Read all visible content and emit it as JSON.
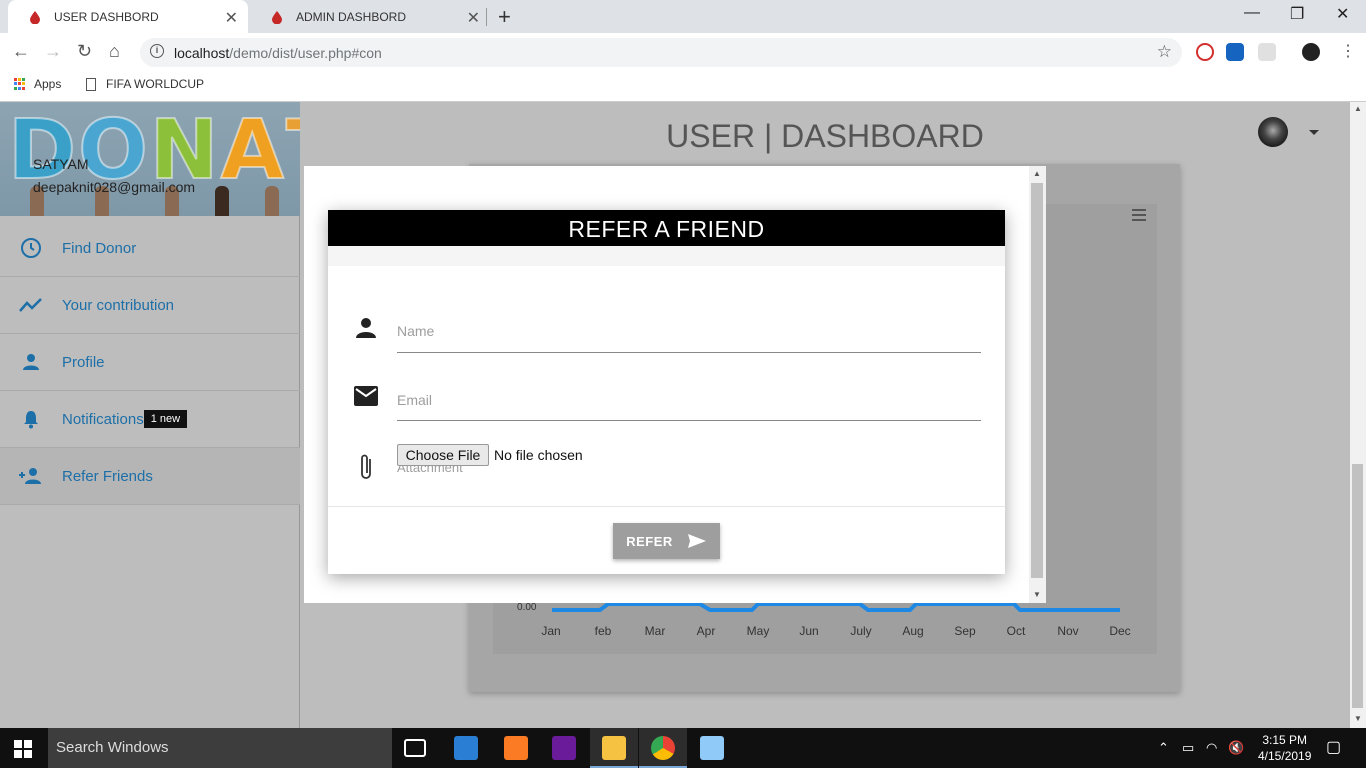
{
  "browser": {
    "tabs": [
      {
        "label": "USER DASHBORD",
        "active": true
      },
      {
        "label": "ADMIN DASHBORD",
        "active": false
      }
    ],
    "url_host": "localhost",
    "url_path": "/demo/dist/user.php#con",
    "bookmarks": [
      {
        "label": "Apps"
      },
      {
        "label": "FIFA WORLDCUP"
      }
    ]
  },
  "sidebar": {
    "banner_text": "DONATE",
    "user_name": "SATYAM",
    "user_email": "deepaknit028@gmail.com",
    "items": [
      {
        "label": "Find Donor",
        "icon": "clock-icon"
      },
      {
        "label": "Your contribution",
        "icon": "trend-icon"
      },
      {
        "label": "Profile",
        "icon": "person-icon"
      },
      {
        "label": "Notifications",
        "icon": "bell-icon",
        "badge": "1 new"
      },
      {
        "label": "Refer Friends",
        "icon": "group-add-icon",
        "selected": true
      }
    ]
  },
  "header": {
    "title": "USER | DASHBOARD"
  },
  "chart": {
    "y_tick": "0.00",
    "months": [
      "Jan",
      "feb",
      "Mar",
      "Apr",
      "May",
      "Jun",
      "July",
      "Aug",
      "Sep",
      "Oct",
      "Nov",
      "Dec"
    ]
  },
  "modal": {
    "title": "REFER A FRIEND",
    "name_placeholder": "Name",
    "email_placeholder": "Email",
    "file_button": "Choose File",
    "file_status": "No file chosen",
    "attachment_placeholder": "Attachment",
    "submit_label": "REFER"
  },
  "taskbar": {
    "search_placeholder": "Search Windows",
    "time": "3:15 PM",
    "date": "4/15/2019"
  },
  "colors": {
    "accent": "#1d6fa8",
    "modal_header": "#000000",
    "chart_line": "#1e88e5"
  }
}
